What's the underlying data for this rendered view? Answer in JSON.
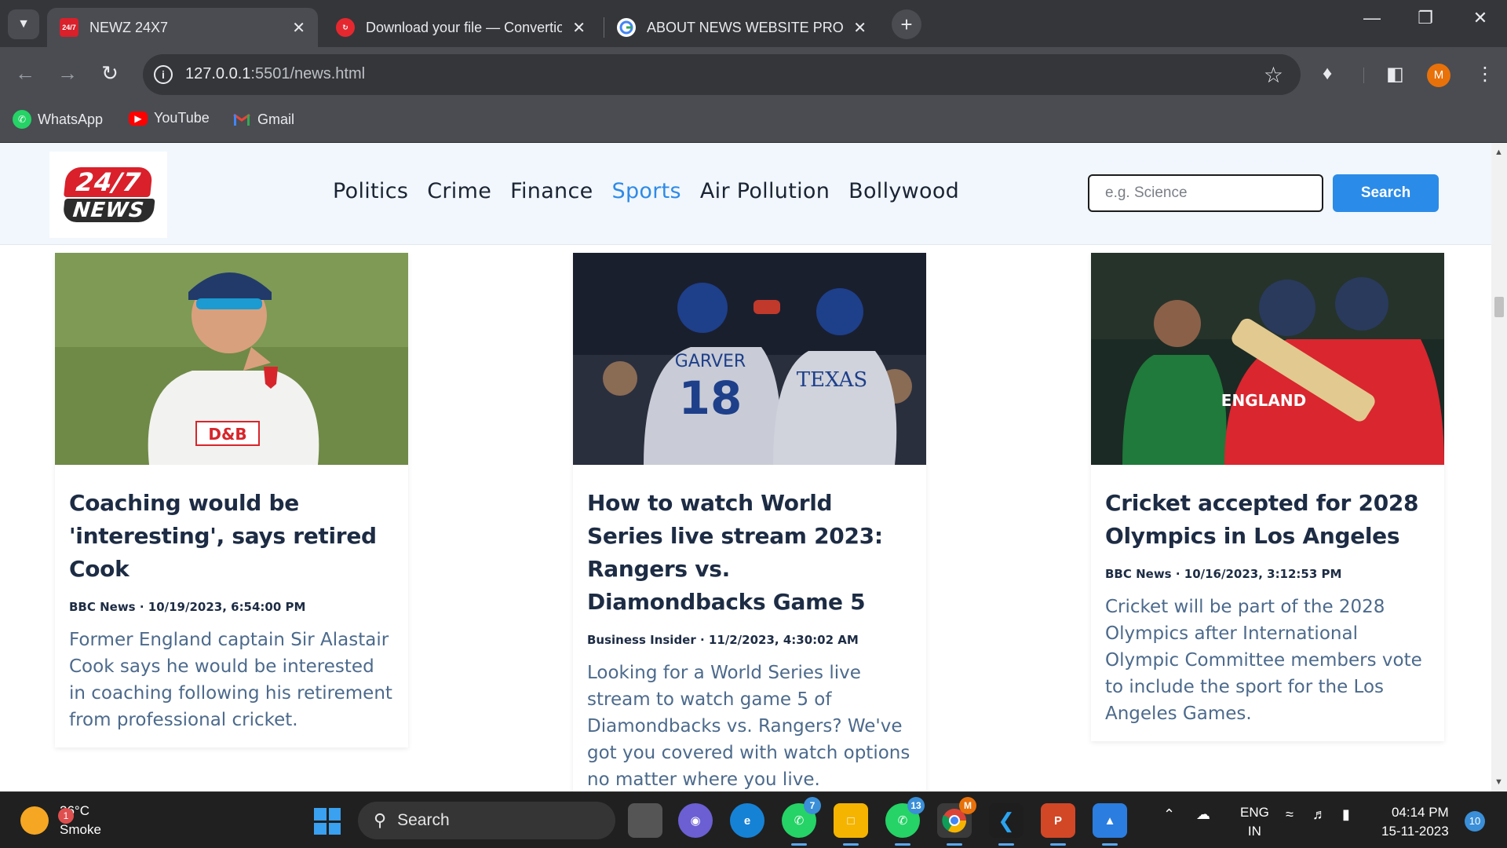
{
  "browser": {
    "tabs": [
      {
        "title": "NEWZ 24X7",
        "favicon": "news-favicon",
        "active": true
      },
      {
        "title": "Download your file — Convertio",
        "favicon": "convertio-favicon",
        "active": false
      },
      {
        "title": "ABOUT NEWS WEBSITE PROJECT",
        "favicon": "google-favicon",
        "active": false
      }
    ],
    "url_host": "127.0.0.1",
    "url_path": ":5501/news.html",
    "profile_initial": "M",
    "bookmarks": [
      {
        "label": "WhatsApp",
        "icon": "whatsapp-icon"
      },
      {
        "label": "YouTube",
        "icon": "youtube-icon"
      },
      {
        "label": "Gmail",
        "icon": "gmail-icon"
      }
    ]
  },
  "site": {
    "logo": {
      "line1": "24/7",
      "line2": "NEWS"
    },
    "nav": [
      "Politics",
      "Crime",
      "Finance",
      "Sports",
      "Air Pollution",
      "Bollywood"
    ],
    "active_nav": "Sports",
    "search": {
      "placeholder": "e.g. Science",
      "button": "Search"
    }
  },
  "articles": [
    {
      "title": "Coaching would be 'interesting', says retired Cook",
      "meta": "BBC News · 10/19/2023, 6:54:00 PM",
      "description": "Former England captain Sir Alastair Cook says he would be interested in coaching following his retirement from professional cricket."
    },
    {
      "title": "How to watch World Series live stream 2023: Rangers vs. Diamondbacks Game 5",
      "meta": "Business Insider · 11/2/2023, 4:30:02 AM",
      "description": "Looking for a World Series live stream to watch game 5 of Diamondbacks vs. Rangers? We've got you covered with watch options no matter where you live."
    },
    {
      "title": "Cricket accepted for 2028 Olympics in Los Angeles",
      "meta": "BBC News · 10/16/2023, 3:12:53 PM",
      "description": "Cricket will be part of the 2028 Olympics after International Olympic Committee members vote to include the sport for the Los Angeles Games."
    }
  ],
  "image_text": {
    "sponsor": "D&B",
    "jersey_name": "GARVER",
    "jersey_number": "18",
    "team": "TEXAS",
    "country": "ENGLAND"
  },
  "taskbar": {
    "weather_temp": "26°C",
    "weather_desc": "Smoke",
    "weather_badge": "1",
    "search_label": "Search",
    "whatsapp_badge": "7",
    "whatsapp2_badge": "13",
    "chrome_badge": "M",
    "lang_top": "ENG",
    "lang_bottom": "IN",
    "time": "04:14 PM",
    "date": "15-11-2023",
    "notifications": "10"
  },
  "colors": {
    "accent": "#2b8be8",
    "nav_bg": "#f1f7fd",
    "title": "#1d2c44",
    "desc": "#4c6a8c"
  }
}
